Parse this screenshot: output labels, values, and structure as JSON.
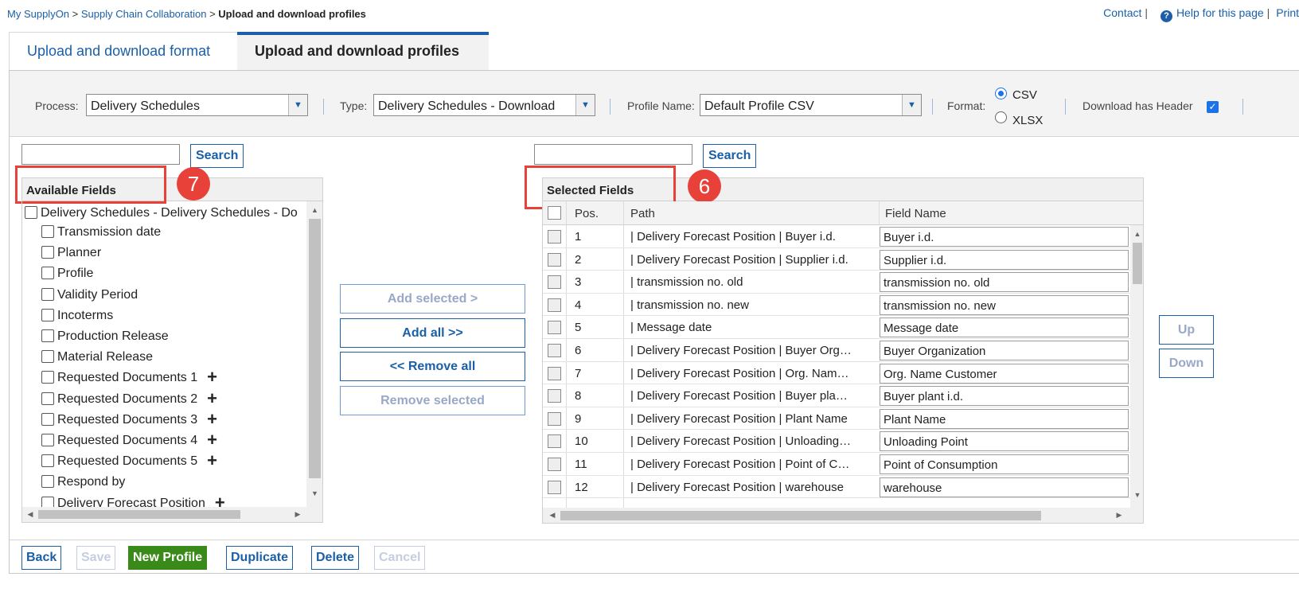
{
  "breadcrumb": {
    "item1": "My SupplyOn",
    "item2": "Supply Chain Collaboration",
    "current": "Upload and download profiles",
    "separator": ">"
  },
  "toplinks": {
    "contact": "Contact",
    "help": "Help for this page",
    "print": "Print",
    "bar": "|"
  },
  "tabs": {
    "format": "Upload and download format",
    "profiles": "Upload and download profiles"
  },
  "filters": {
    "process_label": "Process:",
    "process_value": "Delivery Schedules",
    "type_label": "Type:",
    "type_value": "Delivery Schedules - Download",
    "profile_label": "Profile Name:",
    "profile_value": "Default Profile CSV",
    "format_label": "Format:",
    "format_csv": "CSV",
    "format_xlsx": "XLSX",
    "header_label": "Download has Header"
  },
  "search_label": "Search",
  "available": {
    "title": "Available Fields",
    "badge": "7",
    "root": "Delivery Schedules - Delivery Schedules - Do",
    "items": [
      {
        "label": "Transmission date",
        "expandable": false
      },
      {
        "label": "Planner",
        "expandable": false
      },
      {
        "label": "Profile",
        "expandable": false
      },
      {
        "label": "Validity Period",
        "expandable": false
      },
      {
        "label": "Incoterms",
        "expandable": false
      },
      {
        "label": "Production Release",
        "expandable": false
      },
      {
        "label": "Material Release",
        "expandable": false
      },
      {
        "label": "Requested Documents 1",
        "expandable": true
      },
      {
        "label": "Requested Documents 2",
        "expandable": true
      },
      {
        "label": "Requested Documents 3",
        "expandable": true
      },
      {
        "label": "Requested Documents 4",
        "expandable": true
      },
      {
        "label": "Requested Documents 5",
        "expandable": true
      },
      {
        "label": "Respond by",
        "expandable": false
      },
      {
        "label": "Delivery Forecast Position",
        "expandable": true
      }
    ]
  },
  "middle_buttons": {
    "add_selected": "Add selected >",
    "add_all": "Add all >>",
    "remove_all": "<< Remove all",
    "remove_selected": "Remove selected"
  },
  "selected": {
    "title": "Selected Fields",
    "badge": "6",
    "columns": {
      "pos": "Pos.",
      "path": "Path",
      "field_name": "Field Name"
    },
    "rows": [
      {
        "pos": "1",
        "path": "| Delivery Forecast Position | Buyer i.d.",
        "name": "Buyer i.d."
      },
      {
        "pos": "2",
        "path": "| Delivery Forecast Position | Supplier i.d.",
        "name": "Supplier i.d."
      },
      {
        "pos": "3",
        "path": "| transmission no. old",
        "name": "transmission no. old"
      },
      {
        "pos": "4",
        "path": "| transmission no. new",
        "name": "transmission no. new"
      },
      {
        "pos": "5",
        "path": "| Message date",
        "name": "Message date"
      },
      {
        "pos": "6",
        "path": "| Delivery Forecast Position | Buyer Org…",
        "name": "Buyer Organization"
      },
      {
        "pos": "7",
        "path": "| Delivery Forecast Position | Org. Nam…",
        "name": "Org. Name Customer"
      },
      {
        "pos": "8",
        "path": "| Delivery Forecast Position | Buyer pla…",
        "name": "Buyer plant i.d."
      },
      {
        "pos": "9",
        "path": "| Delivery Forecast Position | Plant Name",
        "name": "Plant Name"
      },
      {
        "pos": "10",
        "path": "| Delivery Forecast Position | Unloading…",
        "name": "Unloading Point"
      },
      {
        "pos": "11",
        "path": "| Delivery Forecast Position | Point of C…",
        "name": "Point of Consumption"
      },
      {
        "pos": "12",
        "path": "| Delivery Forecast Position | warehouse",
        "name": "warehouse"
      }
    ]
  },
  "side_buttons": {
    "up": "Up",
    "down": "Down"
  },
  "footer": {
    "back": "Back",
    "save": "Save",
    "new_profile": "New Profile",
    "duplicate": "Duplicate",
    "delete": "Delete",
    "cancel": "Cancel"
  },
  "icons": {
    "help": "help-circle-icon",
    "dropdown": "chevron-down-icon",
    "expand": "plus-icon",
    "checkbox": "checkbox-icon"
  },
  "colors": {
    "link": "#1a5fa8",
    "annotation": "#e8413a",
    "primary_button": "#3a8a1a",
    "checkbox_checked": "#1a73e8"
  }
}
